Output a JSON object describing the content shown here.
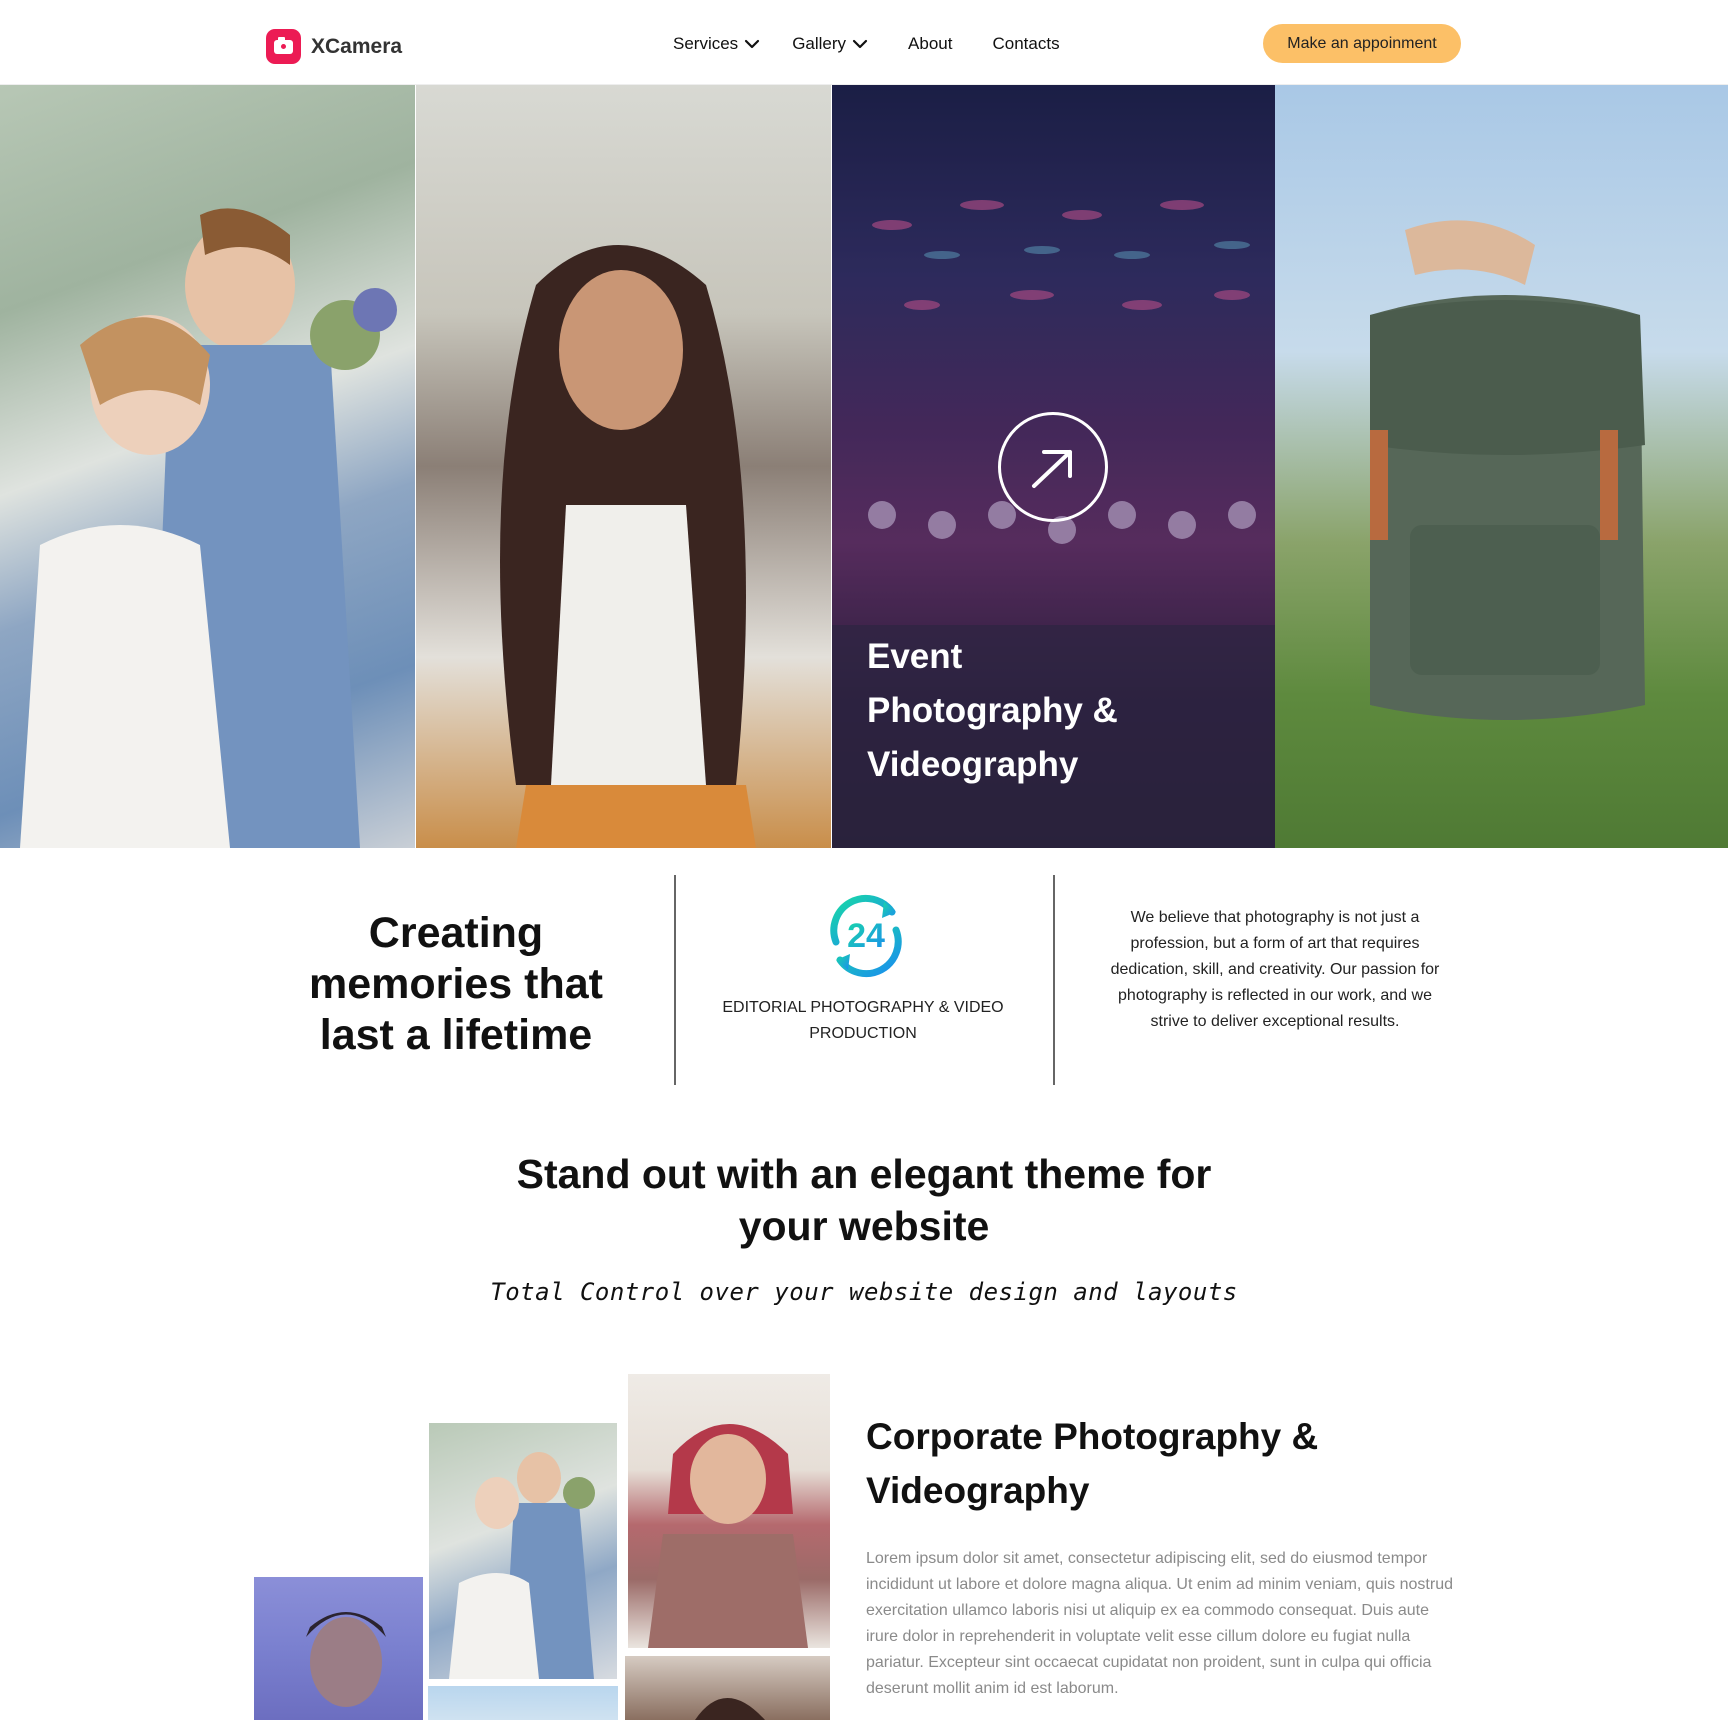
{
  "brand": {
    "name": "XCamera",
    "accent": "#ec1b54",
    "cta_color": "#fcc067"
  },
  "nav": {
    "items": [
      {
        "label": "Services",
        "has_dropdown": true
      },
      {
        "label": "Gallery",
        "has_dropdown": true
      },
      {
        "label": "About",
        "has_dropdown": false
      },
      {
        "label": "Contacts",
        "has_dropdown": false
      }
    ],
    "cta_label": "Make an appoinment"
  },
  "hero": {
    "panels": [
      "wedding-couple-photo",
      "curly-hair-portrait-photo",
      "event-lights-photo",
      "backpack-landscape-photo"
    ],
    "featured_title": "Event Photography & Videography",
    "featured_icon": "arrow-up-right-icon"
  },
  "features": {
    "headline": "Creating memories that last a lifetime",
    "badge_icon": "24-hours-icon",
    "badge_label": "EDITORIAL PHOTOGRAPHY & VIDEO PRODUCTION",
    "description": "We believe that photography is not just a profession, but a form of art that requires dedication, skill, and creativity. Our passion for photography is reflected in our work, and we strive to deliver exceptional results."
  },
  "elegant": {
    "title": "Stand out with an elegant theme for your website",
    "subtitle": "Total Control over your website design and layouts"
  },
  "corporate": {
    "title": "Corporate Photography & Videography",
    "body": "Lorem ipsum dolor sit amet, consectetur adipiscing elit, sed do eiusmod tempor incididunt ut labore et dolore magna aliqua. Ut enim ad minim veniam, quis nostrud exercitation ullamco laboris nisi ut aliquip ex ea commodo consequat. Duis aute irure dolor in reprehenderit in voluptate velit esse cillum dolore eu fugiat nulla pariatur. Excepteur sint occaecat cupidatat non proident, sunt in culpa qui officia deserunt mollit anim id est laborum."
  }
}
